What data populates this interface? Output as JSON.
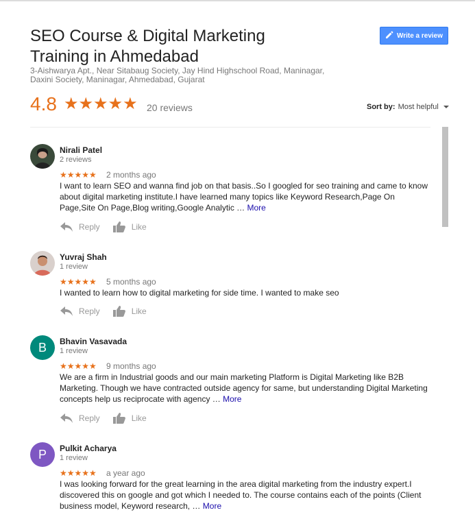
{
  "header": {
    "title": "SEO Course & Digital Marketing Training in Ahmedabad",
    "address": "3-Aishwarya Apt., Near Sitabaug Society, Jay Hind Highschool Road, Maninagar, Daxini Society, Maninagar, Ahmedabad, Gujarat",
    "write_review_label": "Write a review",
    "rating": "4.8",
    "stars": "★★★★★",
    "review_count": "20 reviews",
    "sort_label": "Sort by:",
    "sort_value": "Most helpful"
  },
  "colors": {
    "accent": "#e7711b",
    "button_blue": "#4d90fe",
    "link": "#1a0dab",
    "avatar_b": "#00897b",
    "avatar_p": "#7e57c2"
  },
  "reviews": [
    {
      "name": "Nirali Patel",
      "count": "2 reviews",
      "stars": "★★★★★",
      "time": "2 months ago",
      "text": "I want to learn SEO and wanna find job on that basis..So I googled for seo training and came to know about digital marketing institute.I have learned many topics like Keyword Research,Page On Page,Site On Page,Blog writing,Google Analytic …",
      "more": "More",
      "avatar": "photo"
    },
    {
      "name": "Yuvraj Shah",
      "count": "1 review",
      "stars": "★★★★★",
      "time": "5 months ago",
      "text": "I wanted to learn how to digital marketing for side time. I wanted to make seo",
      "avatar": "photo"
    },
    {
      "name": "Bhavin Vasavada",
      "count": "1 review",
      "stars": "★★★★★",
      "time": "9 months ago",
      "text": "We are a firm in Industrial goods and our main marketing Platform is Digital Marketing like B2B Marketing. Though we have contracted outside agency for same, but understanding Digital Marketing concepts help us reciprocate with agency …",
      "more": "More",
      "avatar_letter": "B"
    },
    {
      "name": "Pulkit Acharya",
      "count": "1 review",
      "stars": "★★★★★",
      "time": "a year ago",
      "text": "I was looking forward for the great learning in the area digital marketing from the industry expert.I discovered this on google and got which I needed to. The course contains each of the points (Client business model, Keyword research, …",
      "more": "More",
      "avatar_letter": "P"
    }
  ],
  "actions": {
    "reply": "Reply",
    "like": "Like"
  }
}
